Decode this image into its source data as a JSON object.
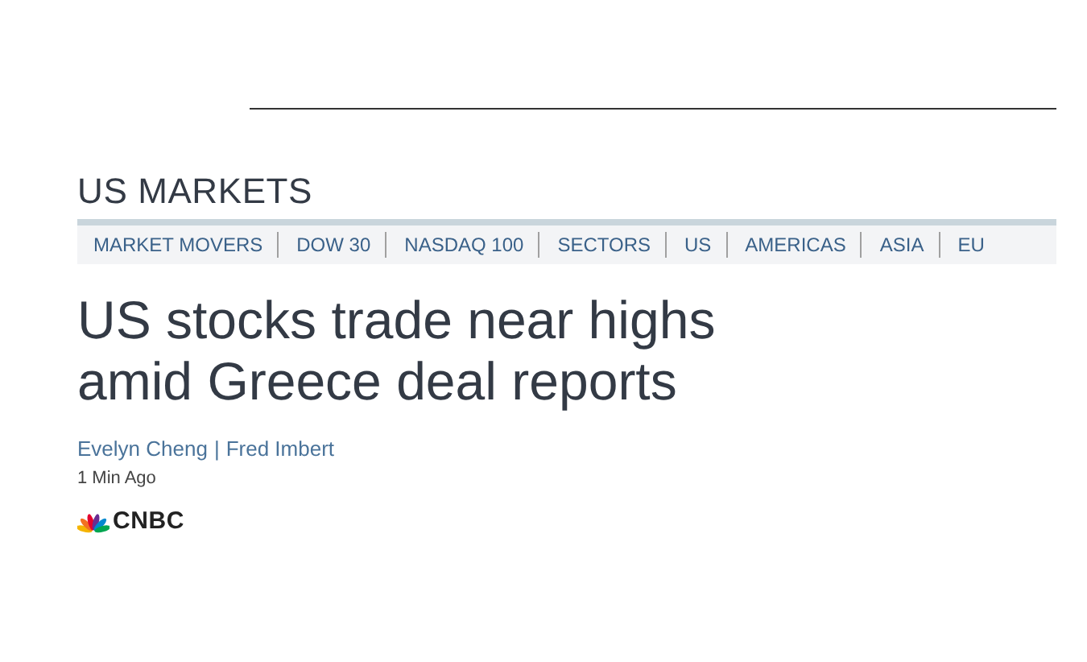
{
  "section": {
    "title": "US MARKETS"
  },
  "nav": [
    {
      "label": "MARKET MOVERS"
    },
    {
      "label": "DOW 30"
    },
    {
      "label": "NASDAQ 100"
    },
    {
      "label": "SECTORS"
    },
    {
      "label": "US"
    },
    {
      "label": "AMERICAS"
    },
    {
      "label": "ASIA"
    },
    {
      "label": "EU"
    }
  ],
  "article": {
    "headline": "US stocks trade near highs amid Greece deal reports",
    "authors": [
      "Evelyn Cheng",
      "Fred Imbert"
    ],
    "separator": "|",
    "time": "1 Min Ago",
    "source": "CNBC"
  }
}
